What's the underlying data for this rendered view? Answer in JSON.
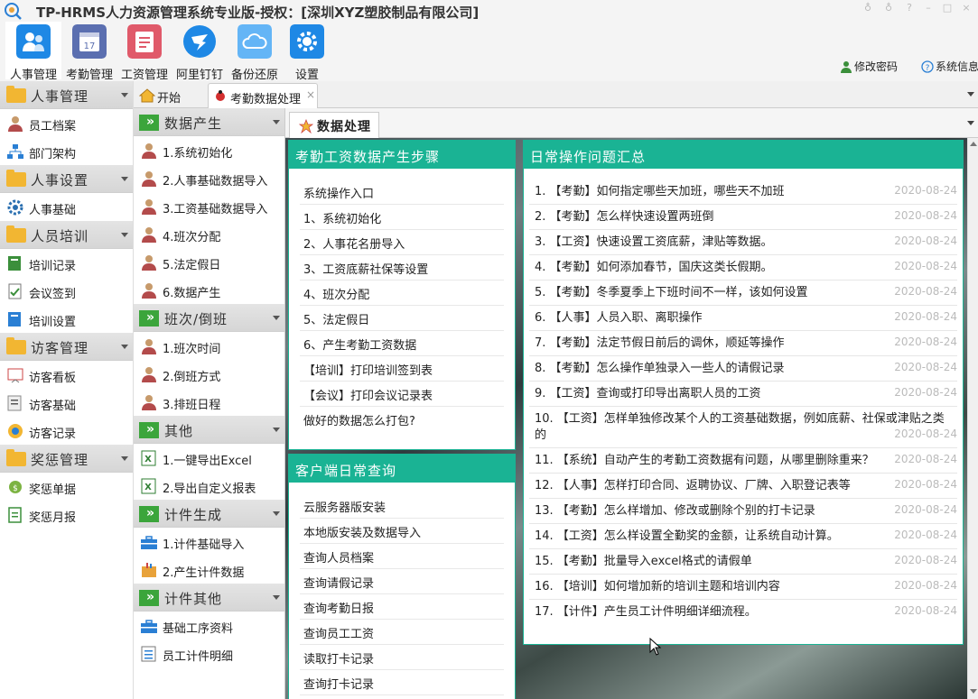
{
  "window": {
    "title": "TP-HRMS人力资源管理系统专业版-授权：[深圳XYZ塑胶制品有限公司]"
  },
  "toolbar": {
    "buttons": [
      {
        "label": "人事管理",
        "color": "#1e88e5"
      },
      {
        "label": "考勤管理",
        "color": "#5b6fb0"
      },
      {
        "label": "工资管理",
        "color": "#e05a6a"
      },
      {
        "label": "阿里钉钉",
        "color": "#1e88e5"
      },
      {
        "label": "备份还原",
        "color": "#64b5f6"
      },
      {
        "label": "设置",
        "color": "#1e88e5"
      }
    ],
    "change_password": "修改密码",
    "system_info": "系统信息"
  },
  "sidebar": {
    "sections": [
      {
        "label": "人事管理",
        "items": [
          "员工档案",
          "部门架构"
        ]
      },
      {
        "label": "人事设置",
        "items": [
          "人事基础"
        ]
      },
      {
        "label": "人员培训",
        "items": [
          "培训记录",
          "会议签到",
          "培训设置"
        ]
      },
      {
        "label": "访客管理",
        "items": [
          "访客看板",
          "访客基础",
          "访客记录"
        ]
      },
      {
        "label": "奖惩管理",
        "items": [
          "奖惩单据",
          "奖惩月报"
        ]
      }
    ]
  },
  "sidebar2": {
    "sections": [
      {
        "label": "数据产生",
        "items": [
          "1.系统初始化",
          "2.人事基础数据导入",
          "3.工资基础数据导入",
          "4.班次分配",
          "5.法定假日",
          "6.数据产生"
        ]
      },
      {
        "label": "班次/倒班",
        "items": [
          "1.班次时间",
          "2.倒班方式",
          "3.排班日程"
        ]
      },
      {
        "label": "其他",
        "items": [
          "1.一键导出Excel",
          "2.导出自定义报表"
        ]
      },
      {
        "label": "计件生成",
        "items": [
          "1.计件基础导入",
          "2.产生计件数据"
        ]
      },
      {
        "label": "计件其他",
        "items": [
          "基础工序资料",
          "员工计件明细"
        ]
      }
    ]
  },
  "tabs": [
    {
      "label": "开始"
    },
    {
      "label": "考勤数据处理"
    }
  ],
  "subtab": {
    "label": "数据处理"
  },
  "steps_panel": {
    "title": "考勤工资数据产生步骤",
    "items": [
      "系统操作入口",
      "1、系统初始化",
      "2、人事花名册导入",
      "3、工资底薪社保等设置",
      "4、班次分配",
      "5、法定假日",
      "6、产生考勤工资数据",
      "【培训】打印培训签到表",
      "【会议】打印会议记录表",
      "做好的数据怎么打包?"
    ]
  },
  "client_panel": {
    "title": "客户端日常查询",
    "items": [
      "云服务器版安装",
      "本地版安装及数据导入",
      "查询人员档案",
      "查询请假记录",
      "查询考勤日报",
      "查询员工工资",
      "读取打卡记录",
      "查询打卡记录"
    ]
  },
  "faq_panel": {
    "title": "日常操作问题汇总",
    "items": [
      {
        "text": "1. 【考勤】如何指定哪些天加班，哪些天不加班",
        "date": "2020-08-24"
      },
      {
        "text": "2. 【考勤】怎么样快速设置两班倒",
        "date": "2020-08-24"
      },
      {
        "text": "3. 【工资】快速设置工资底薪，津贴等数据。",
        "date": "2020-08-24"
      },
      {
        "text": "4. 【考勤】如何添加春节，国庆这类长假期。",
        "date": "2020-08-24"
      },
      {
        "text": "5. 【考勤】冬季夏季上下班时间不一样，该如何设置",
        "date": "2020-08-24"
      },
      {
        "text": "6. 【人事】人员入职、离职操作",
        "date": "2020-08-24"
      },
      {
        "text": "7. 【考勤】法定节假日前后的调休，顺延等操作",
        "date": "2020-08-24"
      },
      {
        "text": "8. 【考勤】怎么操作单独录入一些人的请假记录",
        "date": "2020-08-24"
      },
      {
        "text": "9. 【工资】查询或打印导出离职人员的工资",
        "date": "2020-08-24"
      },
      {
        "text": "10. 【工资】怎样单独修改某个人的工资基础数据，例如底薪、社保或津贴之类的",
        "date": "2020-08-24"
      },
      {
        "text": "11. 【系统】自动产生的考勤工资数据有问题，从哪里删除重来？",
        "date": "2020-08-24"
      },
      {
        "text": "12. 【人事】怎样打印合同、返聘协议、厂牌、入职登记表等",
        "date": "2020-08-24"
      },
      {
        "text": "13. 【考勤】怎么样增加、修改或删除个别的打卡记录",
        "date": "2020-08-24"
      },
      {
        "text": "14. 【工资】怎么样设置全勤奖的金额，让系统自动计算。",
        "date": "2020-08-24"
      },
      {
        "text": "15. 【考勤】批量导入excel格式的请假单",
        "date": "2020-08-24"
      },
      {
        "text": "16. 【培训】如何增加新的培训主题和培训内容",
        "date": "2020-08-24"
      },
      {
        "text": "17. 【计件】产生员工计件明细详细流程。",
        "date": "2020-08-24"
      }
    ]
  },
  "colors": {
    "accent": "#1ab394",
    "folder": "#f2b632",
    "chevron": "#3ba53b"
  }
}
